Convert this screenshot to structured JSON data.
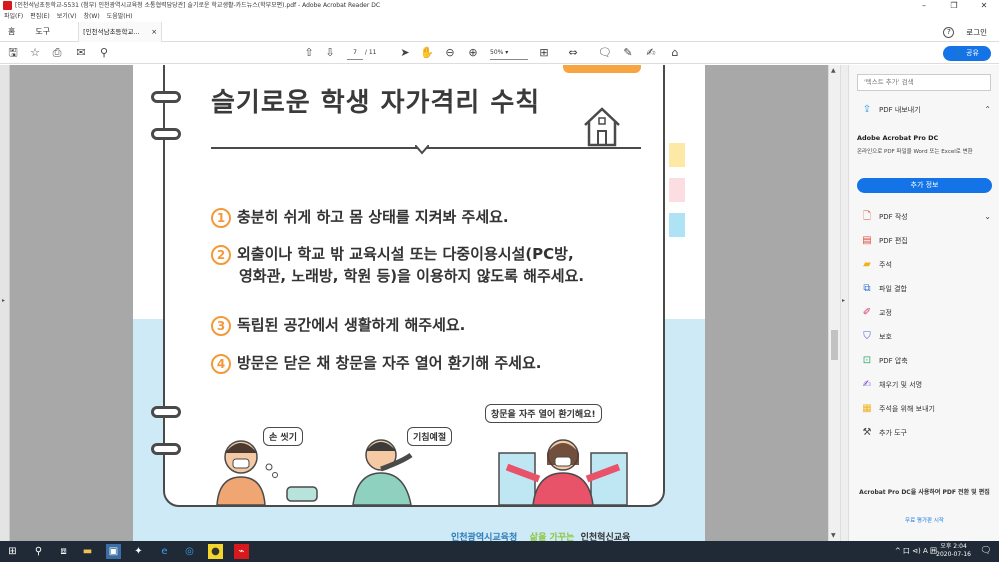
{
  "window": {
    "title": "[인천석남초등학교-5531 (첨부) 인천광역시교육청 소통협력담당관] 슬기로운 학교생활-카드뉴스(학부모편).pdf - Adobe Acrobat Reader DC",
    "controls": [
      "–",
      "❐",
      "✕"
    ]
  },
  "menu": [
    "파일(F)",
    "편집(E)",
    "보기(V)",
    "창(W)",
    "도움말(H)"
  ],
  "tabs": {
    "home": "홈",
    "tools": "도구",
    "document": "[인천석남초등학교...",
    "close": "×",
    "help": "?",
    "login": "로그인"
  },
  "toolbar": {
    "page_current": "7",
    "page_total": "/ 11",
    "zoom": "50%",
    "share": "공유"
  },
  "document": {
    "title": "슬기로운 학생 자가격리 수칙",
    "rules": [
      {
        "num": "1",
        "lines": [
          "충분히 쉬게 하고 몸 상태를 지켜봐 주세요."
        ]
      },
      {
        "num": "2",
        "lines": [
          "외출이나 학교 밖 교육시설 또는 다중이용시설(PC방,",
          "영화관, 노래방, 학원 등)을 이용하지 않도록 해주세요."
        ]
      },
      {
        "num": "3",
        "lines": [
          "독립된 공간에서 생활하게 해주세요."
        ]
      },
      {
        "num": "4",
        "lines": [
          "방문은 닫은 채 창문을 자주 열어 환기해 주세요."
        ]
      }
    ],
    "bubbles": [
      "손 씻기",
      "기침예절",
      "창문을 자주 열어 환기해요!"
    ],
    "footer": [
      "인천광역시교육청",
      "삶을 가꾸는",
      "인천혁신교육"
    ]
  },
  "right_panel": {
    "search_placeholder": "'텍스트 추가' 검색",
    "export_pdf": "PDF 내보내기",
    "promo_title": "Adobe Acrobat Pro DC",
    "promo_body": "온라인으로 PDF 파일을 Word 또는 Excel로 변환",
    "more_info": "추가 정보",
    "tools": [
      "PDF 작성",
      "PDF 편집",
      "주석",
      "파일 결합",
      "교정",
      "보호",
      "PDF 압축",
      "채우기 및 서명",
      "주석을 위해 보내기",
      "추가 도구"
    ],
    "bottom_text": "Acrobat Pro DC을 사용하여 PDF 전환 및 편집",
    "trial": "무료 평가판 시작"
  },
  "taskbar": {
    "tray": "^ 口 ⊲) A 囲",
    "time": "오후 2:04",
    "date": "2020-07-16"
  },
  "colors": {
    "accent": "#1473e6",
    "orange": "#f29a3a",
    "page_blue": "#cdeaf6",
    "taskbar": "#1f2a36"
  }
}
